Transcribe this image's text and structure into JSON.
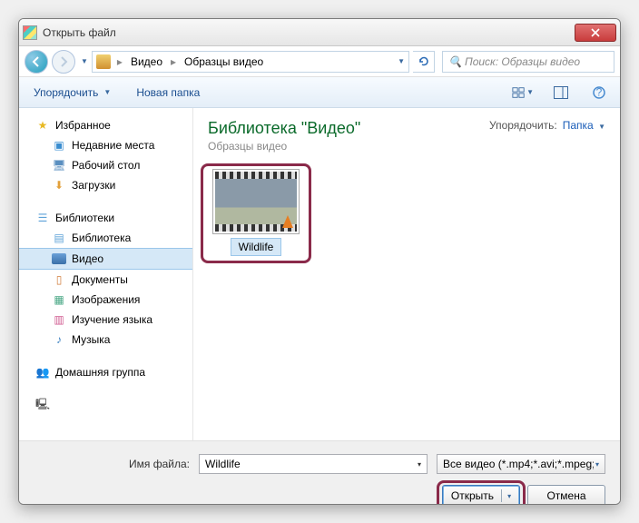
{
  "window": {
    "title": "Открыть файл"
  },
  "nav": {
    "path_parts": [
      "Видео",
      "Образцы видео"
    ],
    "search_placeholder": "Поиск: Образцы видео"
  },
  "toolbar": {
    "organize": "Упорядочить",
    "new_folder": "Новая папка"
  },
  "sidebar": {
    "favorites": {
      "label": "Избранное",
      "items": [
        {
          "label": "Недавние места",
          "icon": "recent"
        },
        {
          "label": "Рабочий стол",
          "icon": "desktop"
        },
        {
          "label": "Загрузки",
          "icon": "download"
        }
      ]
    },
    "libraries": {
      "label": "Библиотеки",
      "items": [
        {
          "label": "Библиотека",
          "icon": "lib"
        },
        {
          "label": "Видео",
          "icon": "video",
          "selected": true
        },
        {
          "label": "Документы",
          "icon": "doc"
        },
        {
          "label": "Изображения",
          "icon": "img"
        },
        {
          "label": "Изучение языка",
          "icon": "study"
        },
        {
          "label": "Музыка",
          "icon": "music"
        }
      ]
    },
    "homegroup": {
      "label": "Домашняя группа"
    }
  },
  "main": {
    "lib_title": "Библиотека \"Видео\"",
    "lib_subtitle": "Образцы видео",
    "arrange_label": "Упорядочить:",
    "arrange_value": "Папка",
    "files": [
      {
        "name": "Wildlife"
      }
    ]
  },
  "footer": {
    "filename_label": "Имя файла:",
    "filename_value": "Wildlife",
    "filter_value": "Все видео (*.mp4;*.avi;*.mpeg;",
    "open_btn": "Открыть",
    "cancel_btn": "Отмена"
  }
}
